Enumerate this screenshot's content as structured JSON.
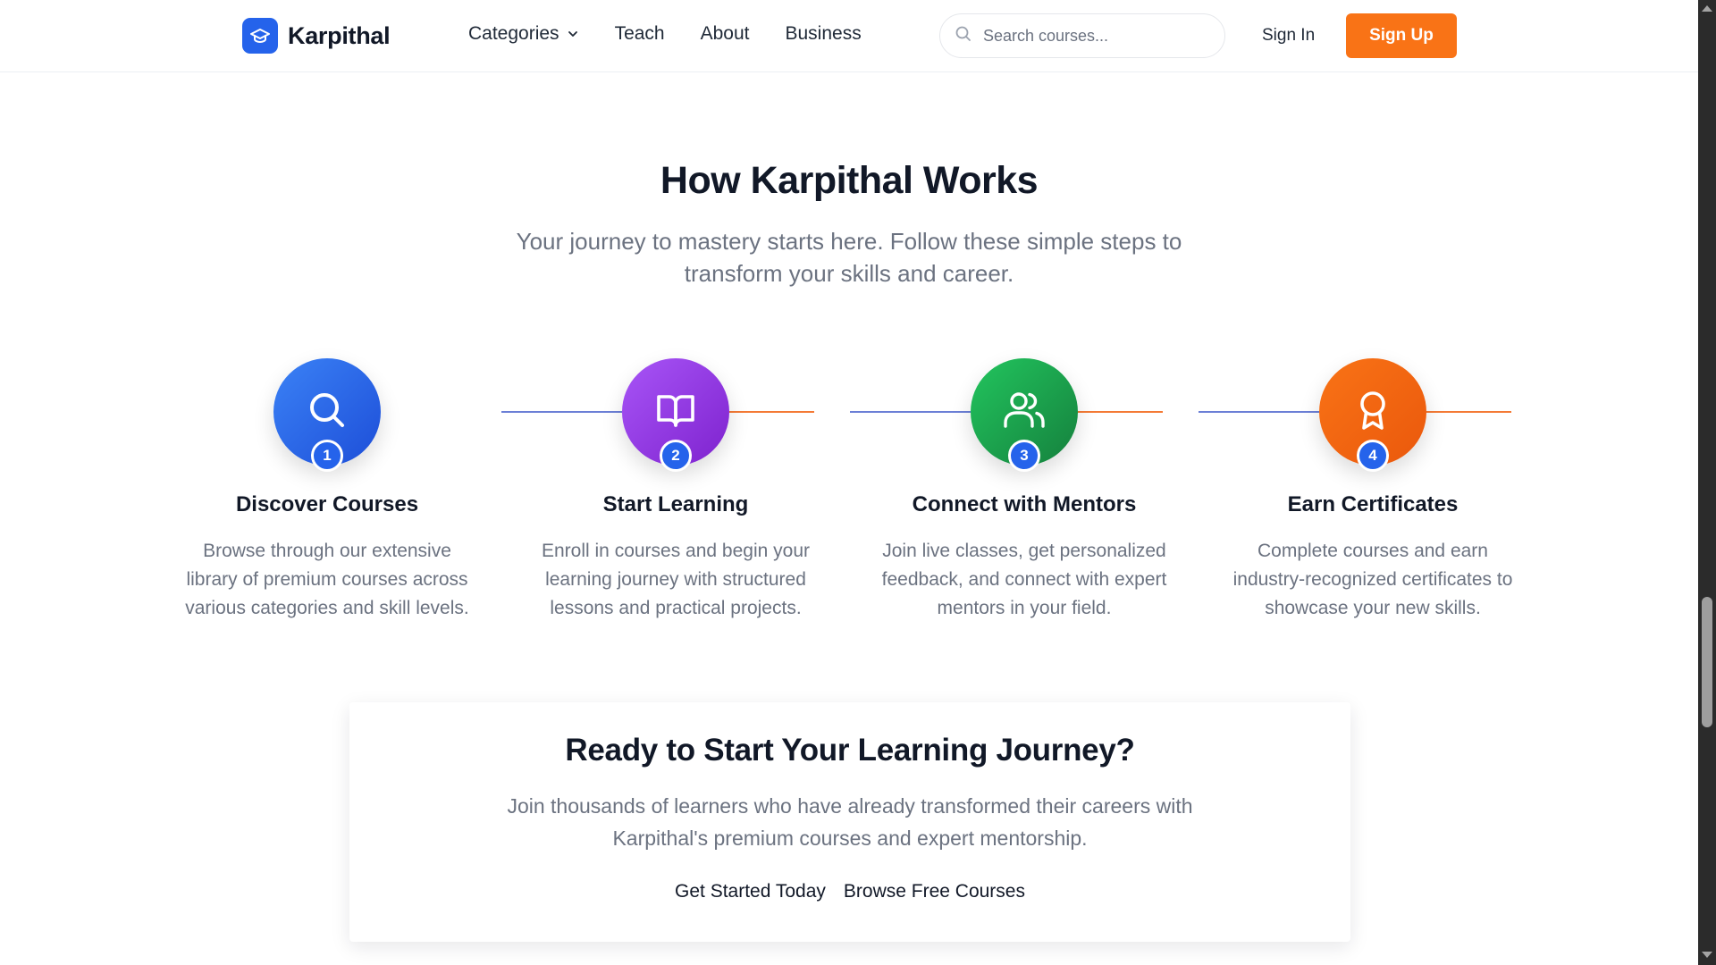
{
  "header": {
    "logo_text": "Karpithal",
    "nav": [
      {
        "label": "Categories"
      },
      {
        "label": "Teach"
      },
      {
        "label": "About"
      },
      {
        "label": "Business"
      }
    ],
    "search_placeholder": "Search courses...",
    "signin_label": "Sign In",
    "signup_label": "Sign Up"
  },
  "how": {
    "title": "How Karpithal Works",
    "subtitle": "Your journey to mastery starts here. Follow these simple steps to transform your skills and career.",
    "steps": [
      {
        "number": "1",
        "icon": "search-icon",
        "title": "Discover Courses",
        "description": "Browse through our extensive library of premium courses across various categories and skill levels.",
        "color": "#2563eb"
      },
      {
        "number": "2",
        "icon": "book-icon",
        "title": "Start Learning",
        "description": "Enroll in courses and begin your learning journey with structured lessons and practical projects.",
        "color": "#9333ea"
      },
      {
        "number": "3",
        "icon": "users-icon",
        "title": "Connect with Mentors",
        "description": "Join live classes, get personalized feedback, and connect with expert mentors in your field.",
        "color": "#16a34a"
      },
      {
        "number": "4",
        "icon": "award-icon",
        "title": "Earn Certificates",
        "description": "Complete courses and earn industry-recognized certificates to showcase your new skills.",
        "color": "#ea580c"
      }
    ]
  },
  "cta": {
    "title": "Ready to Start Your Learning Journey?",
    "subtitle": "Join thousands of learners who have already transformed their careers with Karpithal's premium courses and expert mentorship.",
    "primary_label": "Get Started Today",
    "secondary_label": "Browse Free Courses"
  },
  "colors": {
    "brand": "#2563eb",
    "accent": "#f97316"
  }
}
